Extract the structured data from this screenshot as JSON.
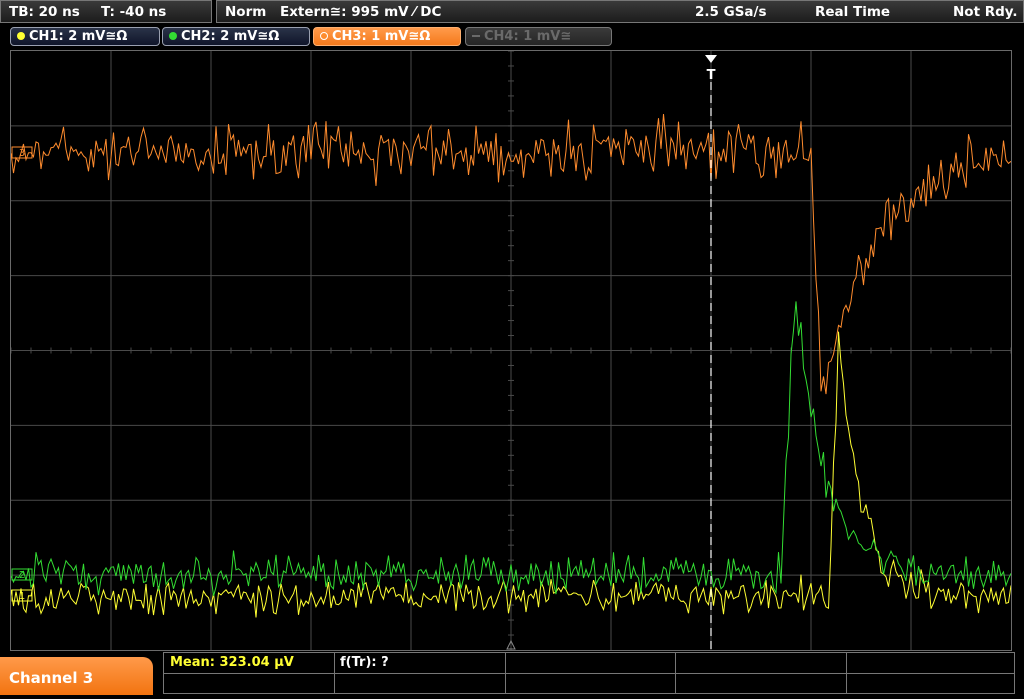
{
  "topbar": {
    "timebase": "TB: 20 ns",
    "trigger_time": "T: -40 ns",
    "mode": "Norm",
    "trigger_source": "Extern≅: 995 mV ⁄ DC",
    "sample_rate": "2.5 GSa/s",
    "acquisition": "Real Time",
    "state": "Not Rdy."
  },
  "channels": [
    {
      "label": "CH1: 2 mV≅Ω",
      "color": "#ffff33",
      "active": true
    },
    {
      "label": "CH2: 2 mV≅Ω",
      "color": "#33dd33",
      "active": true
    },
    {
      "label": "CH3: 1 mV≅Ω",
      "color": "#ff8c2e",
      "active": true
    },
    {
      "label": "CH4: 1 mV≅",
      "color": "#6a6a6a",
      "active": false
    }
  ],
  "markers": {
    "trigger": "T",
    "ch1": "1",
    "ch2": "2",
    "ch3": "3"
  },
  "bottom": {
    "channel_label": "Channel 3",
    "mean": "Mean: 323.04 µV",
    "ftr": "f(Tr): ?"
  },
  "colors": {
    "ch1": "#ffff33",
    "ch2": "#33dd33",
    "ch3": "#ff8c2e",
    "grid": "#4a4a4a",
    "trigger_line": "#ffffff"
  }
}
